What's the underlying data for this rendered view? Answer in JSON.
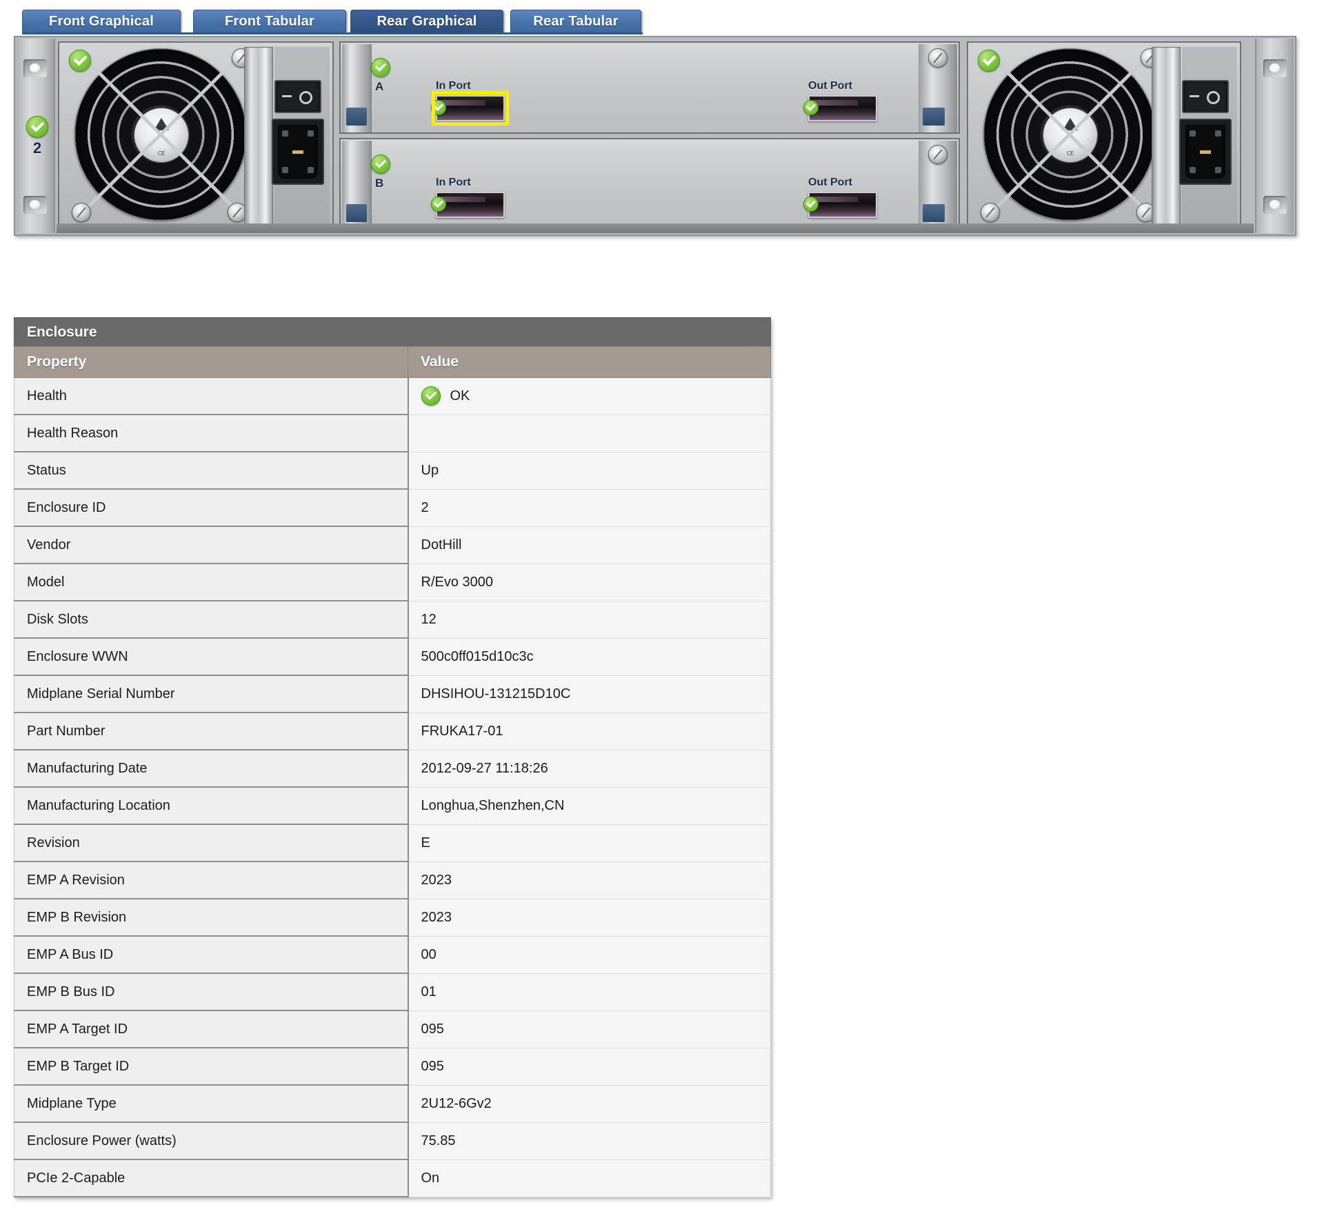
{
  "tabs": [
    {
      "id": "front-graphical",
      "label": "Front Graphical",
      "active": false
    },
    {
      "id": "front-tabular",
      "label": "Front Tabular",
      "active": false
    },
    {
      "id": "rear-graphical",
      "label": "Rear Graphical",
      "active": true
    },
    {
      "id": "rear-tabular",
      "label": "Rear Tabular",
      "active": false
    }
  ],
  "enclosure_graphic": {
    "enclosure_id_label": "2",
    "health_icon": "green-check-ok-icon",
    "modules": [
      {
        "letter": "A",
        "health_icon": "green-check-ok-icon",
        "in_port_label": "In Port",
        "out_port_label": "Out Port",
        "in_port_status_icon": "green-check-ok-icon",
        "out_port_status_icon": "green-check-ok-icon",
        "in_port_selected": true
      },
      {
        "letter": "B",
        "health_icon": "green-check-ok-icon",
        "in_port_label": "In Port",
        "out_port_label": "Out Port",
        "in_port_status_icon": "green-check-ok-icon",
        "out_port_status_icon": "green-check-ok-icon",
        "in_port_selected": false
      }
    ],
    "power_supplies": [
      {
        "position": "left",
        "health_icon": "green-check-ok-icon",
        "switch": "power-rocker-switch",
        "socket": "iec-c14-socket"
      },
      {
        "position": "right",
        "health_icon": "green-check-ok-icon",
        "switch": "power-rocker-switch",
        "socket": "iec-c14-socket"
      }
    ],
    "selection_color": "#ffee00"
  },
  "panel": {
    "title": "Enclosure",
    "columns": [
      "Property",
      "Value"
    ],
    "rows": [
      {
        "property": "Health",
        "value": "OK",
        "icon": "green-check-ok-icon"
      },
      {
        "property": "Health Reason",
        "value": ""
      },
      {
        "property": "Status",
        "value": "Up"
      },
      {
        "property": "Enclosure ID",
        "value": "2"
      },
      {
        "property": "Vendor",
        "value": "DotHill"
      },
      {
        "property": "Model",
        "value": "R/Evo 3000"
      },
      {
        "property": "Disk Slots",
        "value": "12"
      },
      {
        "property": "Enclosure WWN",
        "value": "500c0ff015d10c3c"
      },
      {
        "property": "Midplane Serial Number",
        "value": "DHSIHOU-131215D10C"
      },
      {
        "property": "Part Number",
        "value": "FRUKA17-01"
      },
      {
        "property": "Manufacturing Date",
        "value": "2012-09-27 11:18:26"
      },
      {
        "property": "Manufacturing Location",
        "value": "Longhua,Shenzhen,CN"
      },
      {
        "property": "Revision",
        "value": "E"
      },
      {
        "property": "EMP A Revision",
        "value": "2023"
      },
      {
        "property": "EMP B Revision",
        "value": "2023"
      },
      {
        "property": "EMP A Bus ID",
        "value": "00"
      },
      {
        "property": "EMP B Bus ID",
        "value": "01"
      },
      {
        "property": "EMP A Target ID",
        "value": "095"
      },
      {
        "property": "EMP B Target ID",
        "value": "095"
      },
      {
        "property": "Midplane Type",
        "value": "2U12-6Gv2"
      },
      {
        "property": "Enclosure Power (watts)",
        "value": "75.85"
      },
      {
        "property": "PCIe 2-Capable",
        "value": "On"
      }
    ]
  },
  "colors": {
    "tab_active": "#345788",
    "tab_inactive": "#4a74ad",
    "title_bar": "#6a6a6a",
    "header_row": "#a49a92",
    "ok_green": "#6fbf2f",
    "selection_yellow": "#ffee00"
  }
}
